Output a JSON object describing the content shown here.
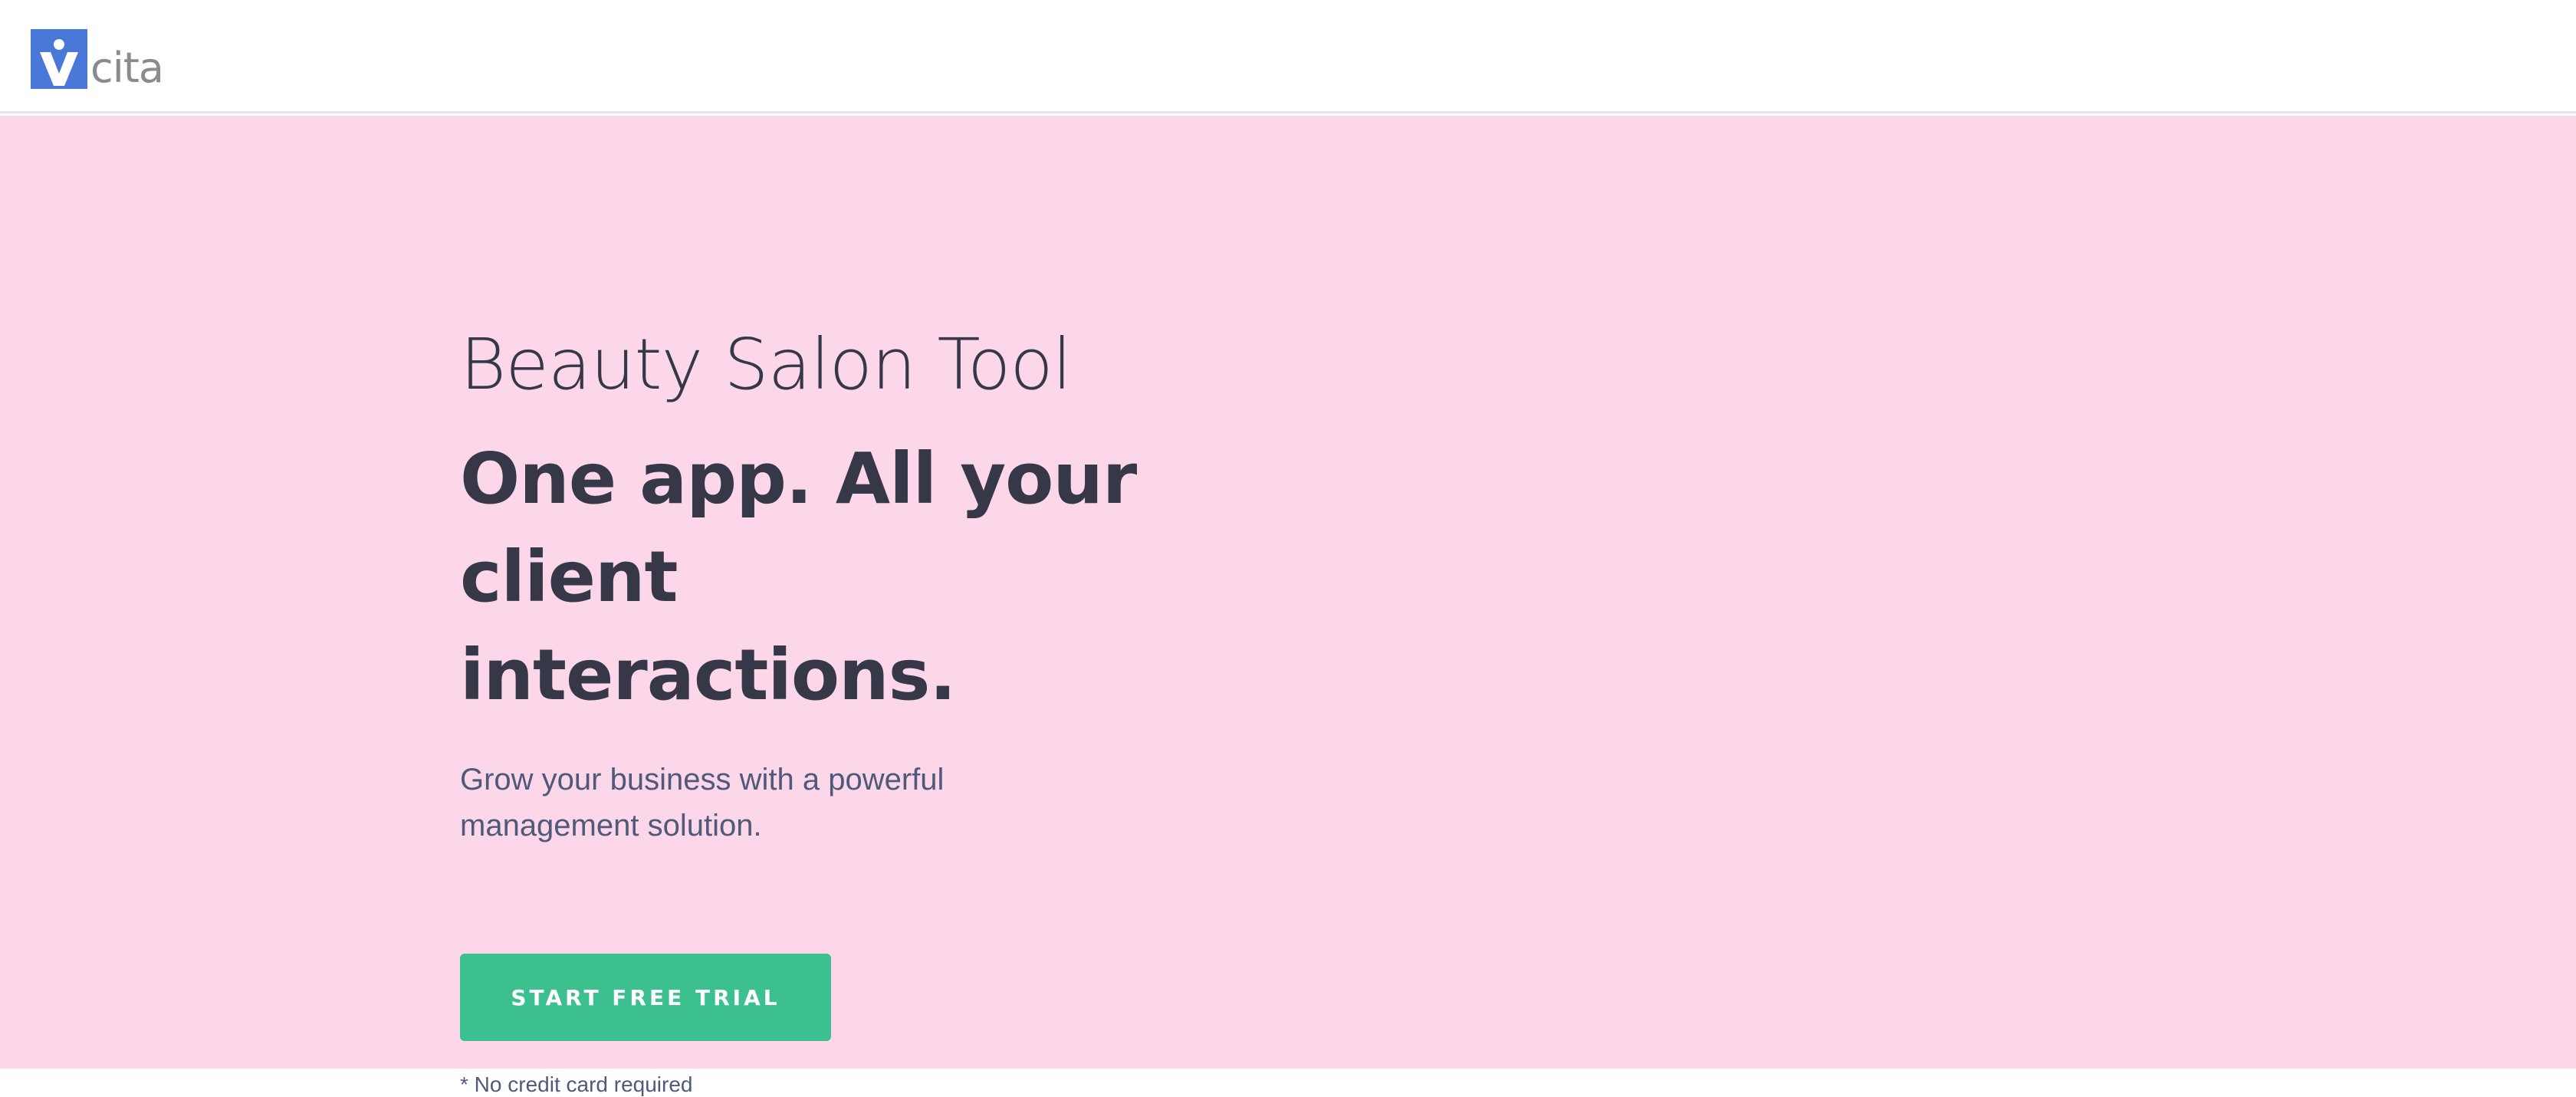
{
  "header": {
    "logo_text": "cita"
  },
  "hero": {
    "title": "Beauty Salon Tool",
    "headline": "One app. All your client interactions.",
    "subtitle": "Grow your business with a powerful management solution.",
    "cta_label": "START FREE TRIAL",
    "note": "* No credit card required"
  },
  "colors": {
    "hero_background": "#fbd7e9",
    "cta": "#3dc08f",
    "brand": "#4a78d8",
    "heading_text": "#363848"
  }
}
